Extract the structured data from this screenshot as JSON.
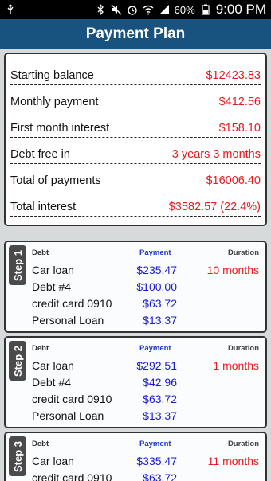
{
  "status_bar": {
    "battery": "60%",
    "time": "9:00 PM"
  },
  "title": "Payment Plan",
  "summary": [
    {
      "label": "Starting balance",
      "value": "$12423.83"
    },
    {
      "label": "Monthly payment",
      "value": "$412.56"
    },
    {
      "label": "First month interest",
      "value": "$158.10"
    },
    {
      "label": "Debt free in",
      "value": "3 years 3 months"
    },
    {
      "label": "Total of payments",
      "value": "$16006.40"
    },
    {
      "label": "Total interest",
      "value": "$3582.57 (22.4%)"
    }
  ],
  "headers": {
    "debt": "Debt",
    "payment": "Payment",
    "duration": "Duration"
  },
  "steps": [
    {
      "label": "Step 1",
      "duration": "10 months",
      "rows": [
        {
          "debt": "Car loan",
          "payment": "$235.47"
        },
        {
          "debt": "Debt #4",
          "payment": "$100.00"
        },
        {
          "debt": "credit card 0910",
          "payment": "$63.72"
        },
        {
          "debt": "Personal Loan",
          "payment": "$13.37"
        }
      ]
    },
    {
      "label": "Step 2",
      "duration": "1 months",
      "rows": [
        {
          "debt": "Car loan",
          "payment": "$292.51"
        },
        {
          "debt": "Debt #4",
          "payment": "$42.96"
        },
        {
          "debt": "credit card 0910",
          "payment": "$63.72"
        },
        {
          "debt": "Personal Loan",
          "payment": "$13.37"
        }
      ]
    },
    {
      "label": "Step 3",
      "duration": "11 months",
      "rows": [
        {
          "debt": "Car loan",
          "payment": "$335.47"
        },
        {
          "debt": "credit card 0910",
          "payment": "$63.72"
        }
      ]
    }
  ]
}
